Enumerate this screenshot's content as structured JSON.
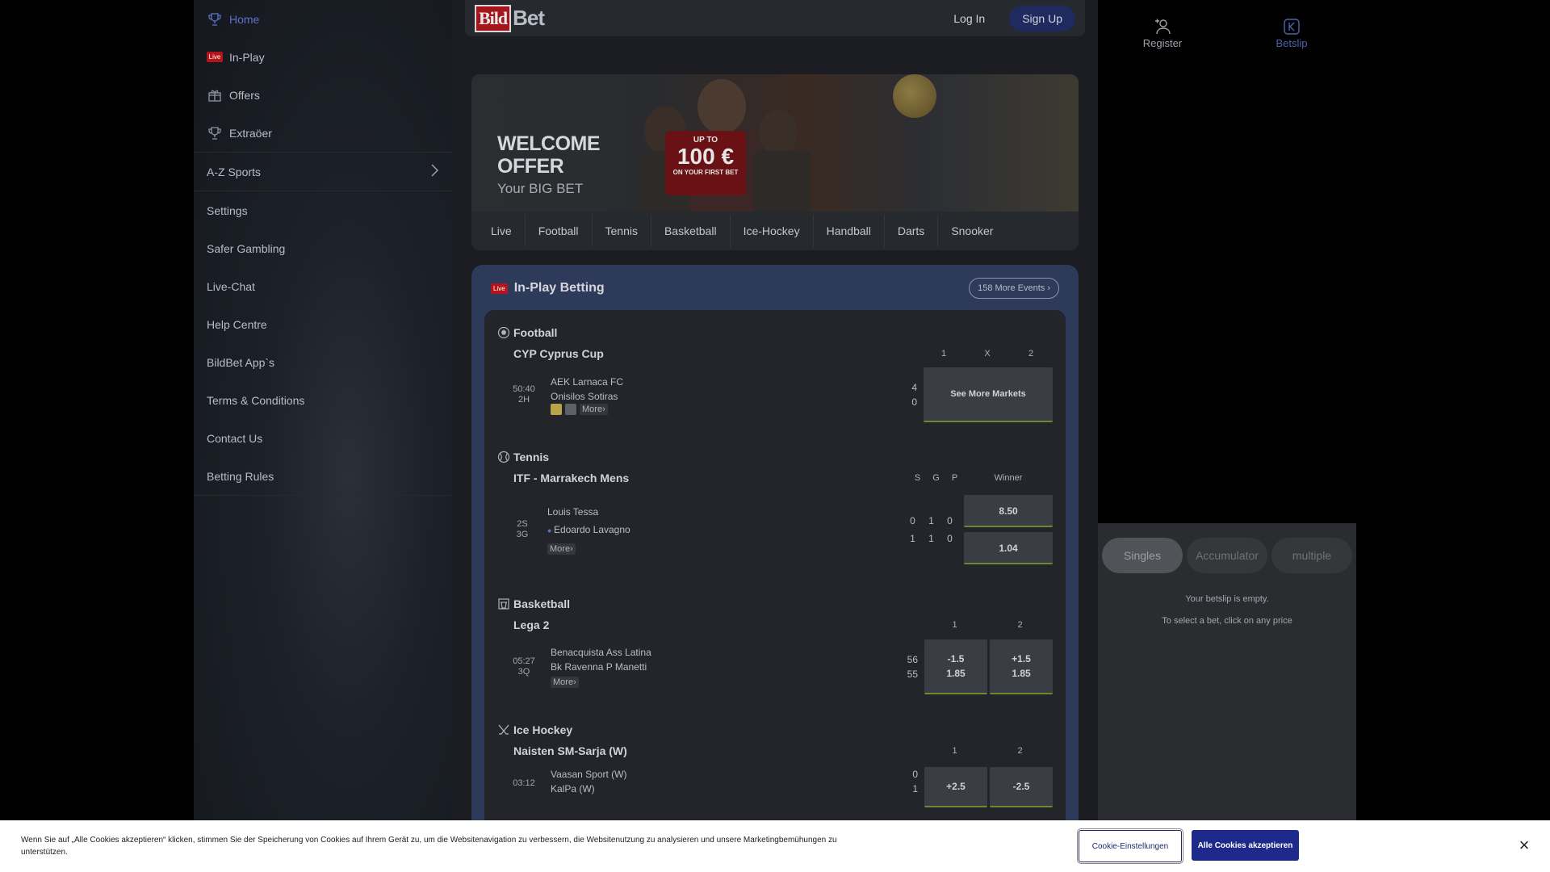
{
  "sidebar": {
    "items": [
      {
        "label": "Home",
        "icon": "trophy-icon"
      },
      {
        "label": "In-Play",
        "badge": "Live"
      },
      {
        "label": "Offers",
        "icon": "gift-icon"
      },
      {
        "label": "Extraöer",
        "icon": "trophy-icon"
      }
    ],
    "az_label": "A-Z Sports",
    "links": [
      "Settings",
      "Safer Gambling",
      "Live-Chat",
      "Help Centre",
      "BildBet App`s",
      "Terms & Conditions",
      "Contact Us",
      "Betting Rules"
    ]
  },
  "header": {
    "logo_part1": "Bild",
    "logo_part2": "Bet",
    "login": "Log In",
    "signup": "Sign Up"
  },
  "banner": {
    "welcome_line1": "WELCOME",
    "welcome_line2": "OFFER",
    "subtitle": "Your BIG BET",
    "badge_top": "UP TO",
    "badge_amount": "100 €",
    "badge_bottom": "ON YOUR FIRST BET"
  },
  "sport_tabs": [
    "Live",
    "Football",
    "Tennis",
    "Basketball",
    "Ice-Hockey",
    "Handball",
    "Darts",
    "Snooker"
  ],
  "inplay": {
    "badge": "Live",
    "title": "In-Play Betting",
    "more_events": "158 More Events",
    "football": {
      "sport": "Football",
      "league": "CYP Cyprus Cup",
      "cols": [
        "1",
        "X",
        "2"
      ],
      "time": "50:40",
      "period": "2H",
      "team1": "AEK Larnaca FC",
      "team2": "Onisilos Sotiras",
      "score1": "4",
      "score2": "0",
      "more": "More",
      "see_more": "See More Markets"
    },
    "tennis": {
      "sport": "Tennis",
      "league": "ITF - Marrakech Mens",
      "cols": [
        "S",
        "G",
        "P",
        "Winner"
      ],
      "time": "2S",
      "period": "3G",
      "player1": "Louis Tessa",
      "player2": "Edoardo Lavagno",
      "p1": [
        "0",
        "1",
        "0"
      ],
      "p2": [
        "1",
        "1",
        "0"
      ],
      "odd1": "8.50",
      "odd2": "1.04",
      "more": "More"
    },
    "basketball": {
      "sport": "Basketball",
      "league": "Lega 2",
      "cols": [
        "1",
        "2"
      ],
      "time": "05:27",
      "period": "3Q",
      "team1": "Benacquista Ass Latina",
      "team2": "Bk Ravenna P Manetti",
      "score1": "56",
      "score2": "55",
      "odd1_line": "-1.5",
      "odd1_val": "1.85",
      "odd2_line": "+1.5",
      "odd2_val": "1.85",
      "more": "More"
    },
    "icehockey": {
      "sport": "Ice Hockey",
      "league": "Naisten SM-Sarja (W)",
      "cols": [
        "1",
        "2"
      ],
      "time": "03:12",
      "team1": "Vaasan Sport (W)",
      "team2": "KalPa (W)",
      "score1": "0",
      "score2": "1",
      "odd1_line": "+2.5",
      "odd2_line": "-2.5"
    }
  },
  "right": {
    "register": "Register",
    "betslip": "Betslip"
  },
  "betslip": {
    "tabs": [
      "Singles",
      "Accumulator",
      "multiple"
    ],
    "empty": "Your betslip is empty.",
    "hint": "To select a bet, click on any price"
  },
  "cookie": {
    "text": "Wenn Sie auf „Alle Cookies akzeptieren“ klicken, stimmen Sie der Speicherung von Cookies auf Ihrem Gerät zu, um die Websitenavigation zu verbessern, die Websitenutzung zu analysieren und unsere Marketingbemühungen zu unterstützen.",
    "settings": "Cookie-Einstellungen",
    "accept": "Alle Cookies akzeptieren",
    "close": "×"
  }
}
